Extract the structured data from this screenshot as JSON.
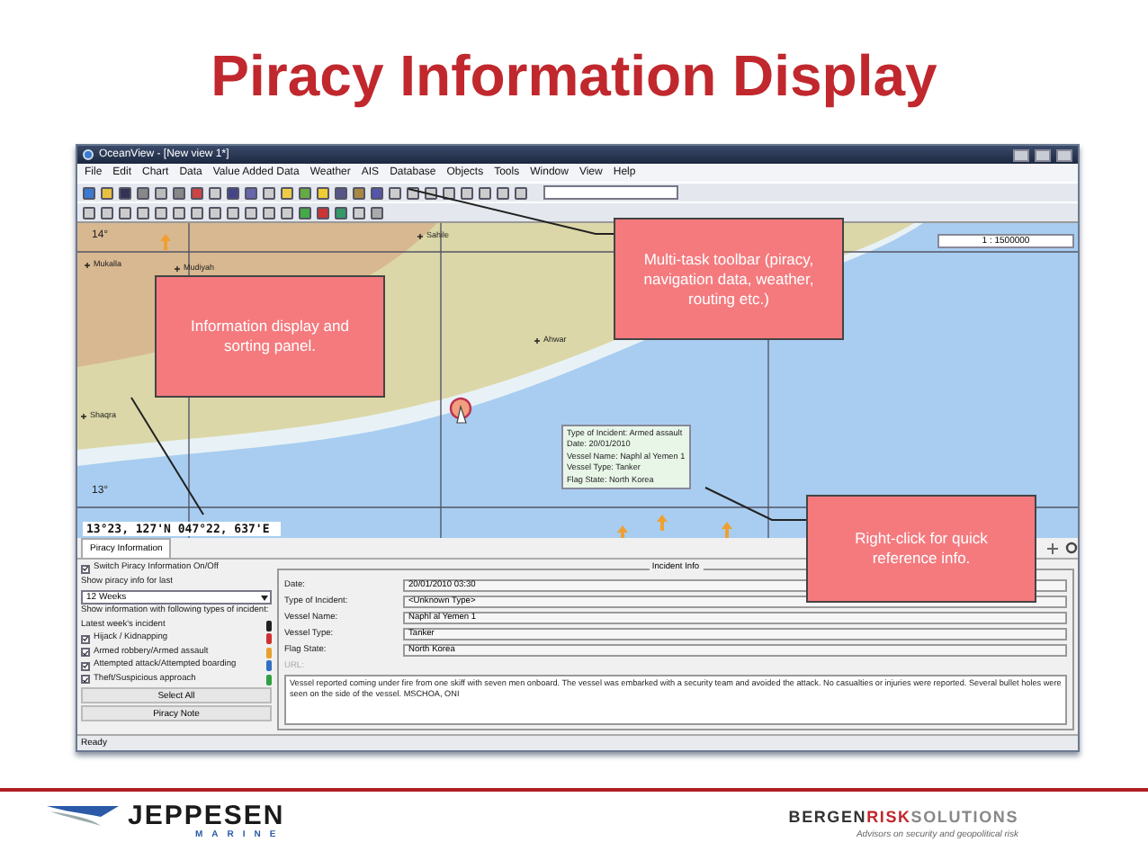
{
  "slide": {
    "title": "Piracy Information Display"
  },
  "window": {
    "title": "OceanView - [New view 1*]",
    "menu": [
      "File",
      "Edit",
      "Chart",
      "Data",
      "Value Added Data",
      "Weather",
      "AIS",
      "Database",
      "Objects",
      "Tools",
      "Window",
      "View",
      "Help"
    ],
    "status": "Ready"
  },
  "map": {
    "places": [
      "Sahile",
      "Mukalla",
      "Mudiyah",
      "Ahwar",
      "Shaqra"
    ],
    "latitudes": [
      "14°",
      "13°"
    ],
    "scale": "1 : 1500000",
    "coordinates": "13°23, 127'N 047°22, 637'E",
    "tooltip": [
      "Type of Incident: Armed assault",
      "Date: 20/01/2010",
      "Vessel Name: Naphl al Yemen 1",
      "Vessel Type: Tanker",
      "Flag State: North Korea"
    ]
  },
  "callouts": [
    "Multi-task toolbar (piracy, navigation data, weather,  routing etc.)",
    "Information display and sorting panel.",
    "Right-click for  quick reference info."
  ],
  "panel": {
    "tab": "Piracy Information",
    "switch": {
      "label": "Switch Piracy Information On/Off",
      "checked": true
    },
    "period_label": "Show piracy info for last",
    "period": "12 Weeks",
    "types_heading": "Show information with following types of incident:",
    "legend": [
      {
        "kind": "label",
        "label": "Latest week's incident",
        "color": "#222222"
      },
      {
        "kind": "checkbox",
        "label": "Hijack / Kidnapping",
        "checked": true,
        "color": "#d03030"
      },
      {
        "kind": "checkbox",
        "label": "Armed robbery/Armed assault",
        "checked": true,
        "color": "#e8a030"
      },
      {
        "kind": "checkbox",
        "label": "Attempted attack/Attempted boarding",
        "checked": true,
        "color": "#3070c0"
      },
      {
        "kind": "checkbox",
        "label": "Theft/Suspicious approach",
        "checked": true,
        "color": "#30a040"
      }
    ],
    "buttons": [
      "Select All",
      "Piracy Note"
    ],
    "incident": {
      "title": "Incident Info",
      "fields": [
        {
          "label": "Date:",
          "value": "20/01/2010 03:30",
          "disabled": false
        },
        {
          "label": "Type of Incident:",
          "value": "<Unknown Type>",
          "disabled": false
        },
        {
          "label": "Vessel Name:",
          "value": "Naphl al Yemen 1",
          "disabled": false
        },
        {
          "label": "Vessel Type:",
          "value": "Tanker",
          "disabled": false
        },
        {
          "label": "Flag State:",
          "value": "North Korea",
          "disabled": false
        },
        {
          "label": "URL:",
          "disabled": true
        }
      ],
      "description": "Vessel reported coming under fire from one skiff with seven men onboard.  The vessel was embarked with a security team and avoided the attack.  No casualties or injuries were reported.  Several bullet holes were seen on the side of the vessel. MSCHOA, ONI"
    }
  },
  "footer": {
    "left_logo": {
      "name": "JEPPESEN",
      "sub": "MARINE"
    },
    "right_logo": {
      "words": [
        {
          "text": "BERGEN",
          "color": "#333333"
        },
        {
          "text": "RISK",
          "color": "#c0282d"
        },
        {
          "text": "SOLUTIONS",
          "color": "#888888"
        }
      ],
      "tagline": "Advisors on security and geopolitical risk"
    }
  }
}
